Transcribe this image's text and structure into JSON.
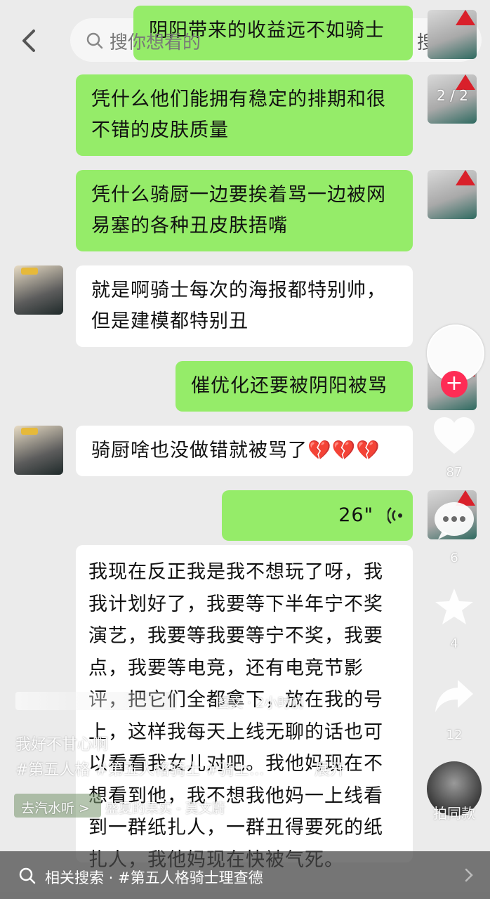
{
  "search": {
    "placeholder": "搜你想看的",
    "button": "搜索"
  },
  "messages": [
    {
      "side": "right",
      "text": "阴阳带来的收益远不如骑士"
    },
    {
      "side": "right",
      "text": "凭什么他们能拥有稳定的排期和很不错的皮肤质量"
    },
    {
      "side": "right",
      "text": "凭什么骑厨一边要挨着骂一边被网易塞的各种丑皮肤捂嘴"
    },
    {
      "side": "left",
      "text": "就是啊骑士每次的海报都特别帅，但是建模都特别丑"
    },
    {
      "side": "right",
      "text": "催优化还要被阴阳被骂"
    },
    {
      "side": "left",
      "text": "骑厨啥也没做错就被骂了💔💔💔"
    },
    {
      "side": "right",
      "voice_duration": "26\""
    },
    {
      "side": "left",
      "text": "我现在反正我是我不想玩了呀，我我计划好了，我要等下半年宁不奖演艺，我要等我要等宁不奖，我要点，我要等电竞，还有电竞节影评，把它们全都拿下，放在我的号上，这样我每天上线无聊的话也可以看看我女儿对吧。我他妈现在不想看到他，我不想我他妈一上线看到一群纸扎人，一群丑得要死的纸扎人，我他妈现在快被气死。"
    }
  ],
  "image_counter": "2 / 2",
  "post": {
    "meta": "· 图文 · 2小时前",
    "caption": "我好不甘心啊",
    "tags": "#第五人格 #第五人格骑士 #骑士...",
    "expand": "展开",
    "music_link": "去汽水听 >",
    "music_title": "盛夏的果实 - 莫文蔚"
  },
  "actions": {
    "like_count": "87",
    "comment_count": "6",
    "favorite_count": "4",
    "share_count": "12",
    "same_style_label": "拍同款"
  },
  "related_search": "相关搜索 · #第五人格骑士理查德"
}
